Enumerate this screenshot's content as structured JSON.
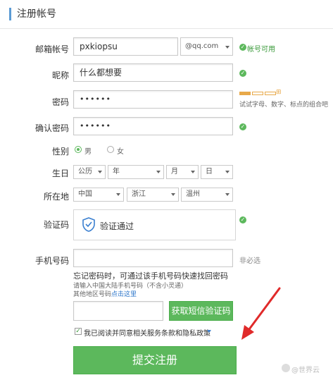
{
  "section_title": "注册帐号",
  "fields": {
    "email": {
      "label": "邮箱帐号",
      "value": "pxkiopsu",
      "domain": "@qq.com",
      "status": "帐号可用"
    },
    "nickname": {
      "label": "昵称",
      "value": "什么都想要"
    },
    "password": {
      "label": "密码",
      "value": "••••••",
      "strength_hint": "试试字母、数字、标点的组合吧"
    },
    "confirm": {
      "label": "确认密码",
      "value": "••••••"
    },
    "gender": {
      "label": "性别",
      "male": "男",
      "female": "女"
    },
    "birthday": {
      "label": "生日",
      "calendar": "公历",
      "year": "年",
      "month": "月",
      "day": "日"
    },
    "location": {
      "label": "所在地",
      "country": "中国",
      "province": "浙江",
      "city": "温州"
    },
    "captcha": {
      "label": "验证码",
      "text": "验证通过"
    },
    "phone": {
      "label": "手机号码",
      "optional": "非必选",
      "help": "忘记密码时，可通过该手机号码快速找回密码",
      "note1": "请输入中国大陆手机号码（不含小灵通）",
      "note2_prefix": "其他地区号码",
      "note2_link": "点击这里"
    },
    "sms_button": "获取短信验证码",
    "agreement": "我已阅读并同意相关服务条款和隐私政策"
  },
  "submit_button": "提交注册",
  "watermark": "@世界云",
  "colors": {
    "accent_green": "#5cb85c",
    "link_blue": "#2a74c9",
    "arrow_red": "#e02a2a"
  }
}
